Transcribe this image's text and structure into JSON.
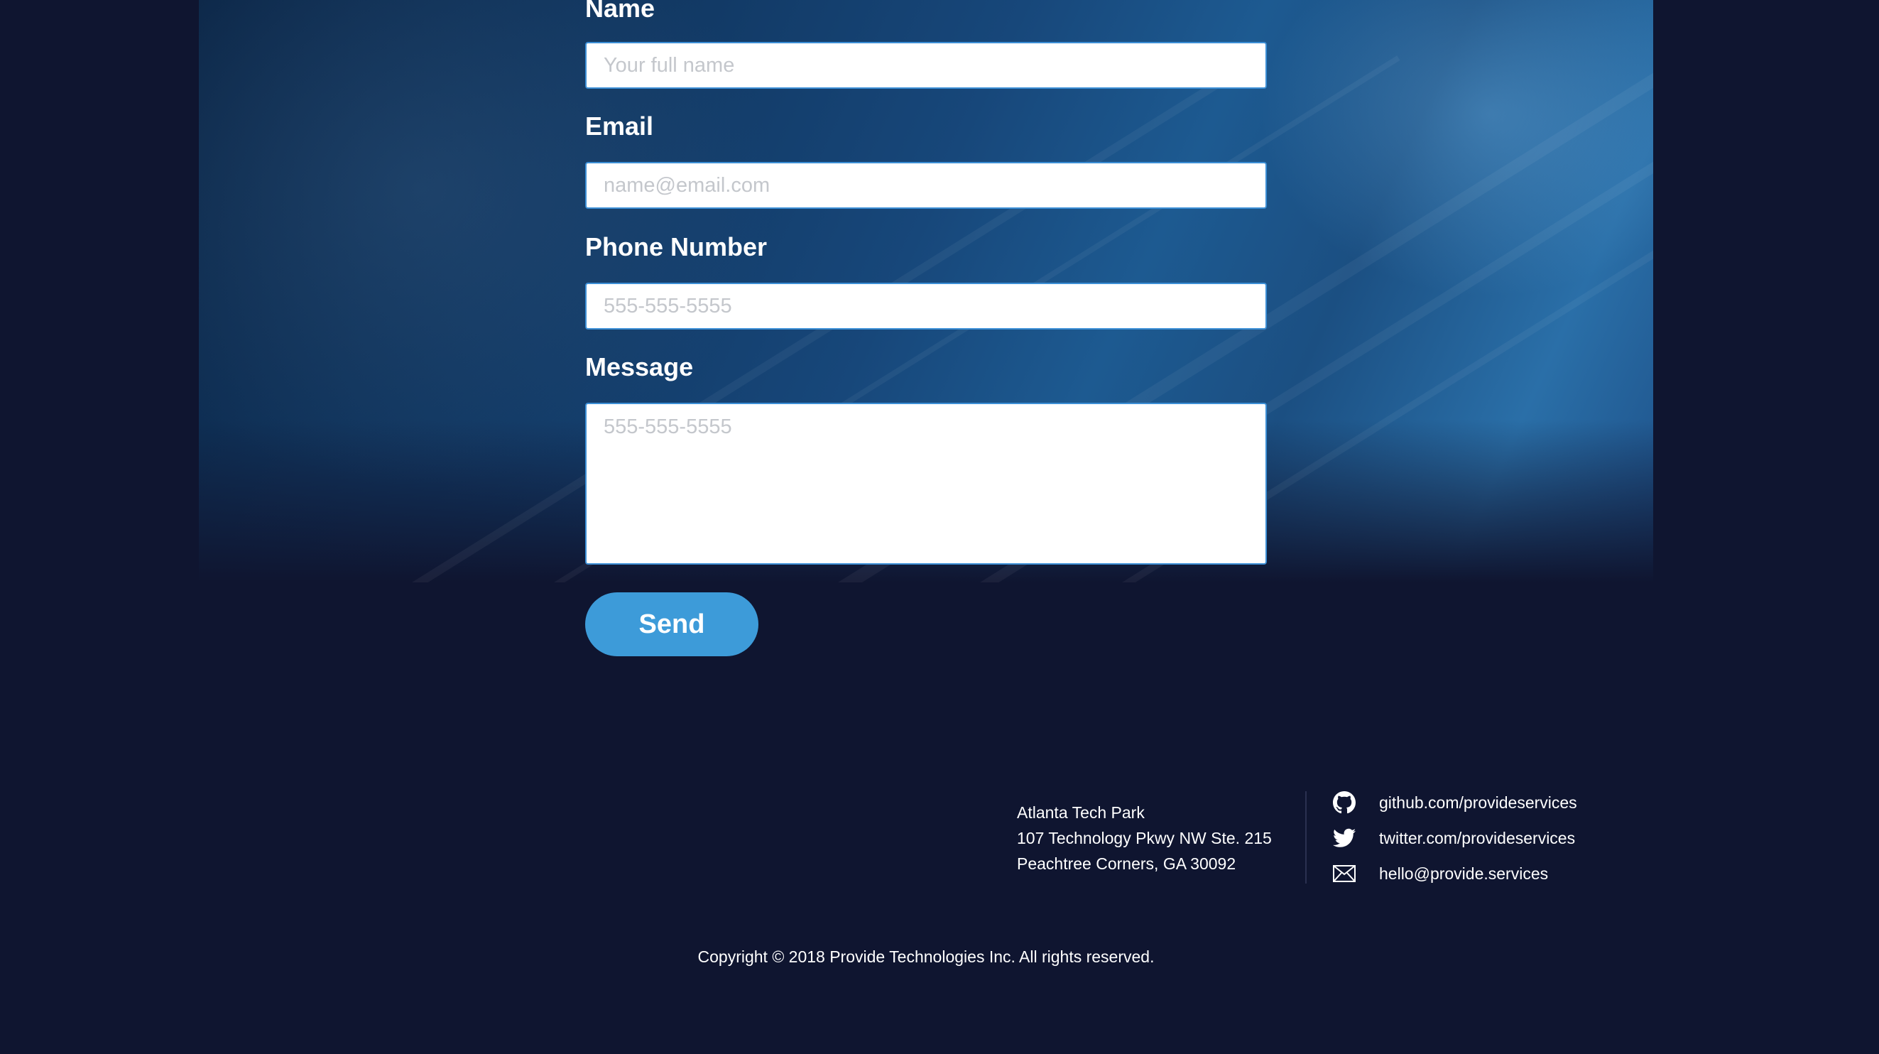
{
  "form": {
    "name_label": "Name",
    "name_placeholder": "Your full name",
    "email_label": "Email",
    "email_placeholder": "name@email.com",
    "phone_label": "Phone Number",
    "phone_placeholder": "555-555-5555",
    "message_label": "Message",
    "message_placeholder": "555-555-5555",
    "send_label": "Send"
  },
  "footer": {
    "address": {
      "line1": "Atlanta Tech Park",
      "line2": "107 Technology Pkwy NW Ste. 215",
      "line3": "Peachtree Corners, GA 30092"
    },
    "contacts": [
      {
        "icon": "github-icon",
        "label": "github.com/provideservices"
      },
      {
        "icon": "twitter-icon",
        "label": "twitter.com/provideservices"
      },
      {
        "icon": "mail-icon",
        "label": "hello@provide.services"
      }
    ],
    "copyright": "Copyright © 2018 Provide Technologies Inc. All rights reserved."
  },
  "colors": {
    "background": "#0f1530",
    "accent": "#3d9bd9",
    "input_border": "#3c8fd6"
  }
}
